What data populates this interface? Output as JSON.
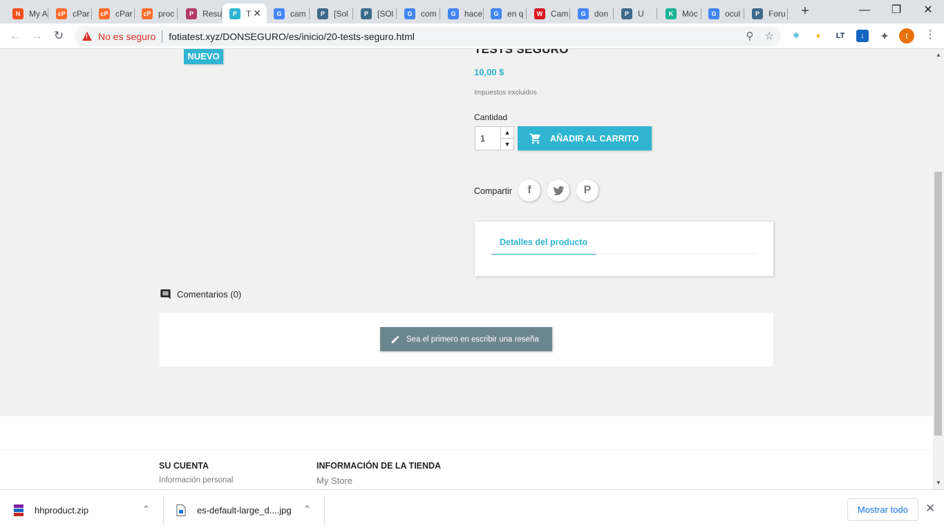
{
  "browser": {
    "tabs": [
      {
        "title": "My A",
        "icon": "n-logo-icon",
        "color": "#f4511e",
        "glyph": "N"
      },
      {
        "title": "cPar",
        "icon": "cpanel-icon",
        "color": "#ff6c2c",
        "glyph": "cP"
      },
      {
        "title": "cPar",
        "icon": "cpanel-icon",
        "color": "#ff6c2c",
        "glyph": "cP"
      },
      {
        "title": "proc",
        "icon": "cpanel-icon",
        "color": "#ff6c2c",
        "glyph": "cP"
      },
      {
        "title": "Resu",
        "icon": "prestashop-icon",
        "color": "#b23a6b",
        "glyph": "P"
      },
      {
        "title": "T",
        "icon": "prestashop-icon",
        "color": "#2fb5d2",
        "glyph": "P"
      },
      {
        "title": "cam",
        "icon": "google-icon",
        "color": "#4285f4",
        "glyph": "G"
      },
      {
        "title": "[Sol",
        "icon": "prestashop-icon",
        "color": "#3c6a8a",
        "glyph": "P"
      },
      {
        "title": "[SOl",
        "icon": "prestashop-icon",
        "color": "#3c6a8a",
        "glyph": "P"
      },
      {
        "title": "com",
        "icon": "google-icon",
        "color": "#4285f4",
        "glyph": "G"
      },
      {
        "title": "hace",
        "icon": "google-icon",
        "color": "#4285f4",
        "glyph": "G"
      },
      {
        "title": "en q",
        "icon": "google-icon",
        "color": "#4285f4",
        "glyph": "G"
      },
      {
        "title": "Cam",
        "icon": "w-logo-icon",
        "color": "#d71920",
        "glyph": "W"
      },
      {
        "title": "don",
        "icon": "google-icon",
        "color": "#4285f4",
        "glyph": "G"
      },
      {
        "title": "U",
        "icon": "prestashop-icon",
        "color": "#3c6a8a",
        "glyph": "P"
      },
      {
        "title": "Móc",
        "icon": "k-logo-icon",
        "color": "#1ab394",
        "glyph": "K"
      },
      {
        "title": "ocul",
        "icon": "google-icon",
        "color": "#4285f4",
        "glyph": "G"
      },
      {
        "title": "Foru",
        "icon": "prestashop-icon",
        "color": "#3c6a8a",
        "glyph": "P"
      }
    ],
    "security_label": "No es seguro",
    "url": "fotiatest.xyz/DONSEGURO/es/inicio/20-tests-seguro.html",
    "profile_initial": "t"
  },
  "product": {
    "badge": "NUEVO",
    "title": "TESTS SEGURO",
    "price": "10,00 $",
    "tax_note": "Impuestos excluidos",
    "quantity_label": "Cantidad",
    "quantity_value": "1",
    "add_to_cart": "AÑADIR AL CARRITO",
    "share_label": "Compartir",
    "tab_details": "Detalles del producto"
  },
  "comments": {
    "heading": "Comentarios (0)",
    "first_review": "Sea el primero en escribir una reseña"
  },
  "footer": {
    "account_heading": "SU CUENTA",
    "account_link": "Información personal",
    "store_heading": "INFORMACIÓN DE LA TIENDA",
    "store_name": "My Store"
  },
  "downloads": {
    "items": [
      {
        "name": "hhproduct.zip"
      },
      {
        "name": "es-default-large_d....jpg"
      }
    ],
    "show_all": "Mostrar todo"
  },
  "colors": {
    "accent": "#2fb5d2",
    "review_button": "#6c868e",
    "warning": "#d93025"
  }
}
